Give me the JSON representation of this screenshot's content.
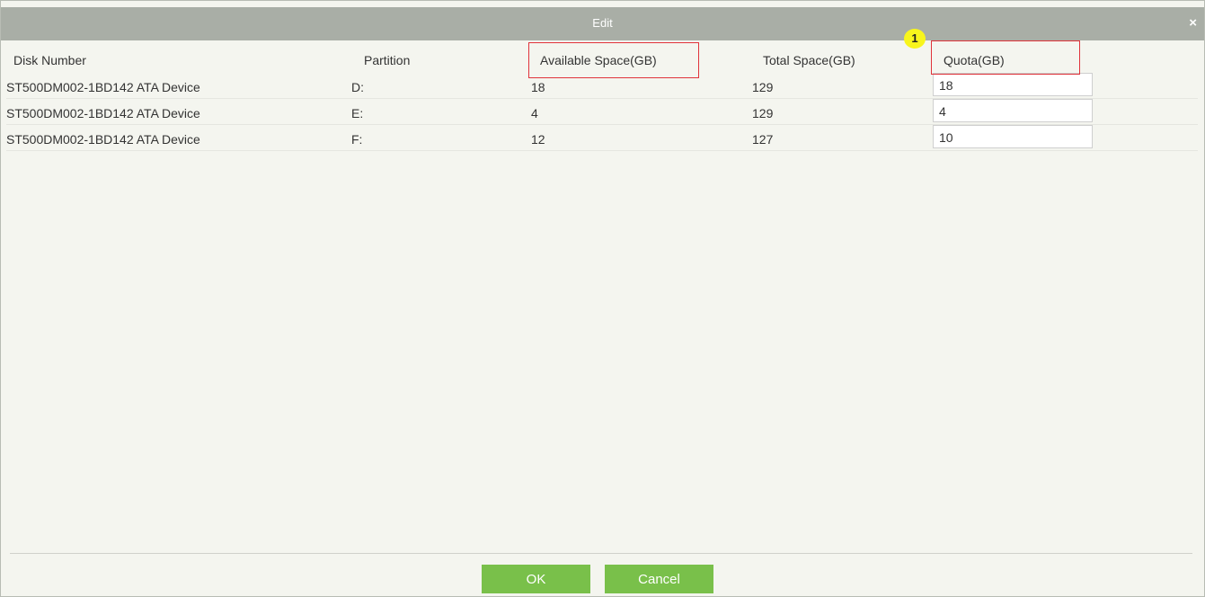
{
  "dialog": {
    "title": "Edit",
    "close_label": "×"
  },
  "table": {
    "headers": {
      "disk": "Disk Number",
      "partition": "Partition",
      "available": "Available Space(GB)",
      "total": "Total Space(GB)",
      "quota": "Quota(GB)"
    },
    "rows": [
      {
        "disk": "ST500DM002-1BD142 ATA Device",
        "partition": "D:",
        "available": "18",
        "total": "129",
        "quota": "18"
      },
      {
        "disk": "ST500DM002-1BD142 ATA Device",
        "partition": "E:",
        "available": "4",
        "total": "129",
        "quota": "4"
      },
      {
        "disk": "ST500DM002-1BD142 ATA Device",
        "partition": "F:",
        "available": "12",
        "total": "127",
        "quota": "10"
      }
    ]
  },
  "annotation": {
    "badge_number": "1",
    "highlight_color": "#e0333a",
    "badge_color": "#f8f51c"
  },
  "footer": {
    "ok_label": "OK",
    "cancel_label": "Cancel",
    "button_color": "#79c04a"
  }
}
